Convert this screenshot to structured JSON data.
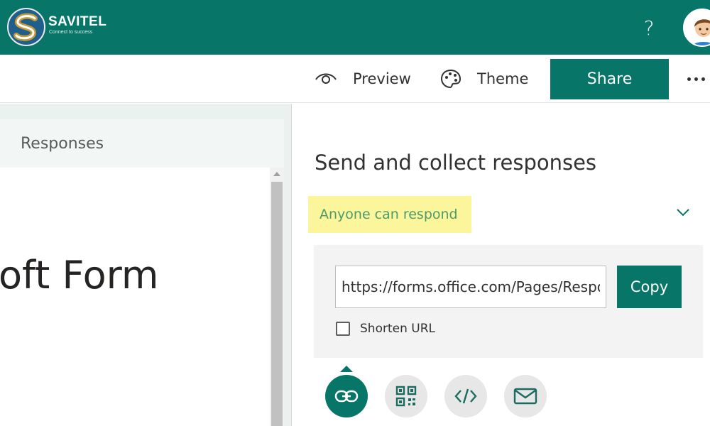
{
  "brand": {
    "name": "SAVITEL",
    "tagline": "Connect to success"
  },
  "topbar": {
    "help_label": "?"
  },
  "commandbar": {
    "preview_label": "Preview",
    "theme_label": "Theme",
    "share_label": "Share"
  },
  "left_pane": {
    "responses_tab": "Responses",
    "form_title_fragment": "oft Form"
  },
  "share_panel": {
    "title": "Send and collect responses",
    "audience_selected": "Anyone can respond",
    "link_value": "https://forms.office.com/Pages/ResponsePage.aspx",
    "copy_label": "Copy",
    "shorten_label": "Shorten URL",
    "shorten_checked": false,
    "options": [
      "link-icon",
      "qr-code-icon",
      "embed-code-icon",
      "email-icon"
    ],
    "active_option": "link-icon"
  },
  "colors": {
    "accent": "#077568",
    "highlight": "#fbf59b"
  }
}
